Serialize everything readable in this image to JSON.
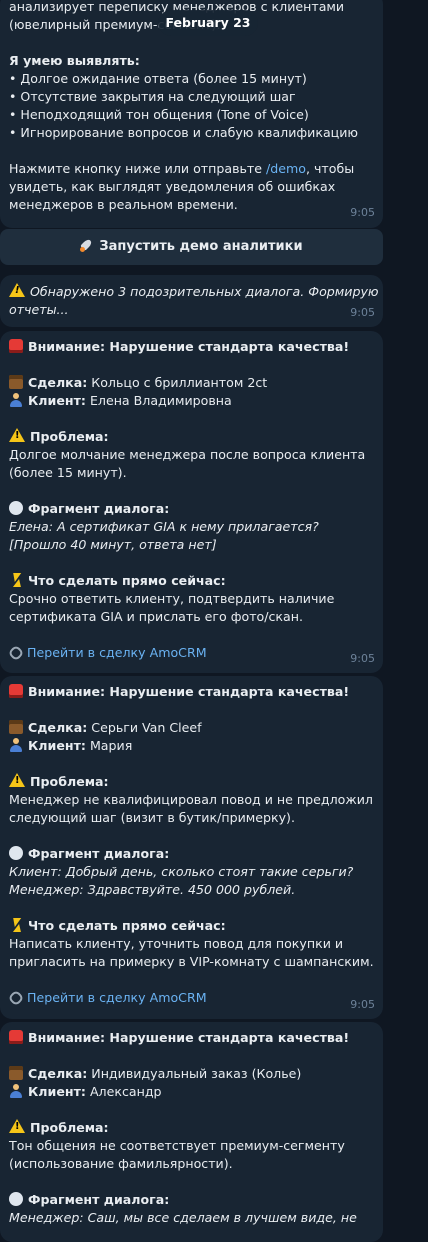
{
  "date_pill": "February 23",
  "intro": {
    "lines": [
      "анализирует переписку менеджеров с клиентами",
      "(ювелирный премиум-сегмент)."
    ],
    "heading": "Я умею выявлять:",
    "bullets": [
      "• Долгое ожидание ответа (более 15 минут)",
      "• Отсутствие закрытия на следующий шаг",
      "• Неподходящий тон общения (Tone of Voice)",
      "• Игнорирование вопросов и слабую квалификацию"
    ],
    "cta_before": "Нажмите кнопку ниже или отправьте ",
    "cta_command": "/demo",
    "cta_after": ", чтобы",
    "cta_lines": [
      "увидеть, как выглядят уведомления об ошибках",
      "менеджеров в реальном времени."
    ],
    "time": "9:05"
  },
  "demo_button": {
    "icon": "rocket-icon",
    "label": "Запустить демо аналитики"
  },
  "notice": {
    "lines": [
      "Обнаружено 3 подозрительных диалога. Формирую",
      "отчеты..."
    ],
    "time": "9:05"
  },
  "labels": {
    "alert": "Внимание: Нарушение стандарта качества!",
    "deal": "Сделка:",
    "client": "Клиент:",
    "problem": "Проблема:",
    "fragment": "Фрагмент диалога:",
    "action": "Что сделать прямо сейчас:",
    "crm_link": "Перейти в сделку AmoCRM"
  },
  "alerts": [
    {
      "deal": "Кольцо с бриллиантом 2ct",
      "client": "Елена Владимировна",
      "problem_lines": [
        "Долгое молчание менеджера после вопроса клиента",
        "(более 15 минут)."
      ],
      "fragment_lines": [
        "Елена: А сертификат GIA к нему прилагается?",
        "[Прошло 40 минут, ответа нет]"
      ],
      "action_lines": [
        "Срочно ответить клиенту, подтвердить наличие",
        "сертификата GIA и прислать его фото/скан."
      ],
      "time": "9:05"
    },
    {
      "deal": "Серьги Van Cleef",
      "client": "Мария",
      "problem_lines": [
        "Менеджер не квалифицировал повод и не предложил",
        "следующий шаг (визит в бутик/примерку)."
      ],
      "fragment_lines": [
        "Клиент: Добрый день, сколько стоят такие серьги?",
        "Менеджер: Здравствуйте. 450 000 рублей."
      ],
      "action_lines": [
        "Написать клиенту, уточнить повод для покупки и",
        "пригласить на примерку в VIP-комнату с шампанским."
      ],
      "time": "9:05"
    },
    {
      "deal": "Индивидуальный заказ (Колье)",
      "client": "Александр",
      "problem_lines": [
        "Тон общения не соответствует премиум-сегменту",
        "(использование фамильярности)."
      ],
      "fragment_lines": [
        "Менеджер: Саш, мы все сделаем в лучшем виде, не"
      ],
      "action_lines": [],
      "time": ""
    }
  ],
  "colors": {
    "background": "#0f1722",
    "bubble": "#182533",
    "link": "#6ab2f2",
    "time": "#6d8299"
  }
}
